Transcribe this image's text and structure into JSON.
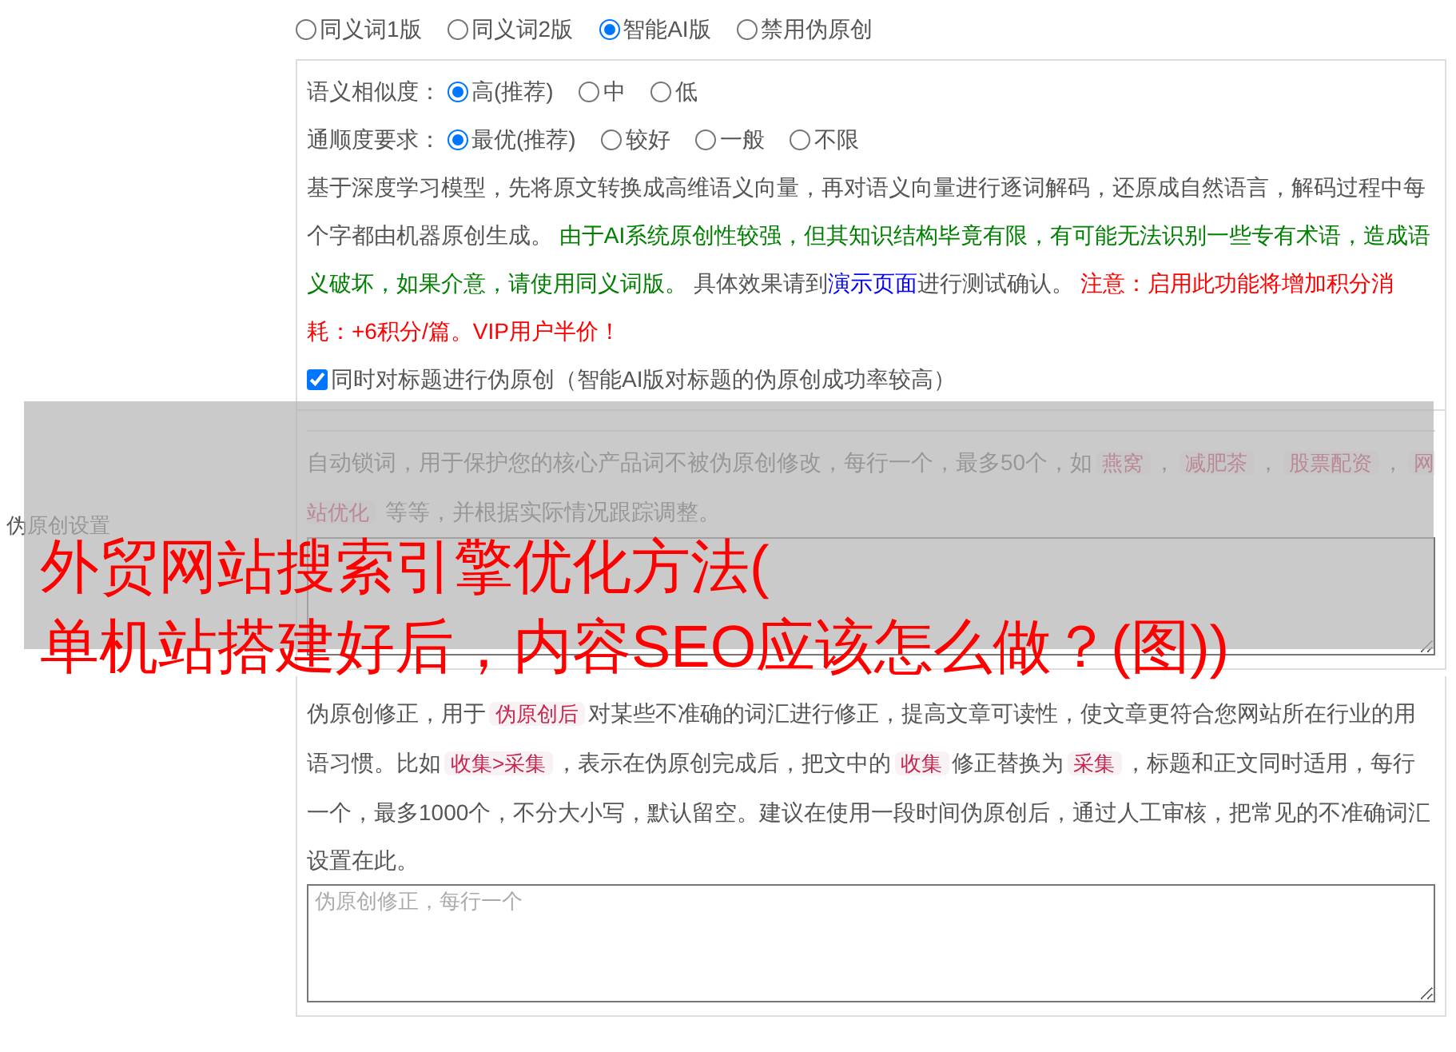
{
  "version_options": [
    {
      "label": "同义词1版",
      "selected": false
    },
    {
      "label": "同义词2版",
      "selected": false
    },
    {
      "label": "智能AI版",
      "selected": true
    },
    {
      "label": "禁用伪原创",
      "selected": false
    }
  ],
  "ai_panel": {
    "similarity": {
      "label": "语义相似度：",
      "options": [
        {
          "label": "高(推荐)",
          "selected": true
        },
        {
          "label": "中",
          "selected": false
        },
        {
          "label": "低",
          "selected": false
        }
      ]
    },
    "fluency": {
      "label": "通顺度要求：",
      "options": [
        {
          "label": "最优(推荐)",
          "selected": true
        },
        {
          "label": "较好",
          "selected": false
        },
        {
          "label": "一般",
          "selected": false
        },
        {
          "label": "不限",
          "selected": false
        }
      ]
    },
    "description": [
      {
        "kind": "plain",
        "text": "基于深度学习模型，先将原文转换成高维语义向量，再对语义向量进行逐词解码，还原成自然语言，解码过程中每个字都由机器原创生成。 "
      },
      {
        "kind": "note",
        "text": "由于AI系统原创性较强，但其知识结构毕竟有限，有可能无法识别一些专有术语，造成语义破坏，如果介意，请使用同义词版。"
      },
      {
        "kind": "plain",
        "text": " 具体效果请到"
      },
      {
        "kind": "link",
        "text": "演示页面"
      },
      {
        "kind": "plain",
        "text": "进行测试确认。 "
      },
      {
        "kind": "warning",
        "text": "注意：启用此功能将增加积分消耗：+6积分/篇。VIP用户半价！"
      }
    ],
    "title_option": {
      "label": "同时对标题进行伪原创（智能AI版对标题的伪原创成功率较高）",
      "checked": true
    }
  },
  "section_label": "伪原创设置",
  "lock_words": {
    "description": [
      {
        "kind": "plain",
        "text": "自动锁词，用于保护您的核心产品词不被伪原创修改，每行一个，最多50个，如"
      },
      {
        "kind": "code",
        "text": "燕窝"
      },
      {
        "kind": "plain",
        "text": "，"
      },
      {
        "kind": "code",
        "text": "减肥茶"
      },
      {
        "kind": "plain",
        "text": "，"
      },
      {
        "kind": "code",
        "text": "股票配资"
      },
      {
        "kind": "plain",
        "text": "，"
      },
      {
        "kind": "code",
        "text": "网站优化"
      },
      {
        "kind": "plain",
        "text": " 等等，并根据实际情况跟踪调整。"
      }
    ]
  },
  "correction": {
    "description": [
      {
        "kind": "plain",
        "text": "伪原创修正，用于"
      },
      {
        "kind": "code",
        "text": "伪原创后"
      },
      {
        "kind": "plain",
        "text": "对某些不准确的词汇进行修正，提高文章可读性，使文章更符合您网站所在行业的用语习惯。比如"
      },
      {
        "kind": "code",
        "text": "收集>采集"
      },
      {
        "kind": "plain",
        "text": "，表示在伪原创完成后，把文中的"
      },
      {
        "kind": "code",
        "text": "收集"
      },
      {
        "kind": "plain",
        "text": "修正替换为"
      },
      {
        "kind": "code",
        "text": "采集"
      },
      {
        "kind": "plain",
        "text": "，标题和正文同时适用，每行一个，最多1000个，不分大小写，默认留空。建议在使用一段时间伪原创后，通过人工审核，把常见的不准确词汇设置在此。"
      }
    ],
    "placeholder": "伪原创修正，每行一个"
  },
  "overlay": {
    "lines": [
      "外贸网站搜索引擎优化方法(",
      "单机站搭建好后，内容SEO应该怎么做？(图))"
    ]
  }
}
